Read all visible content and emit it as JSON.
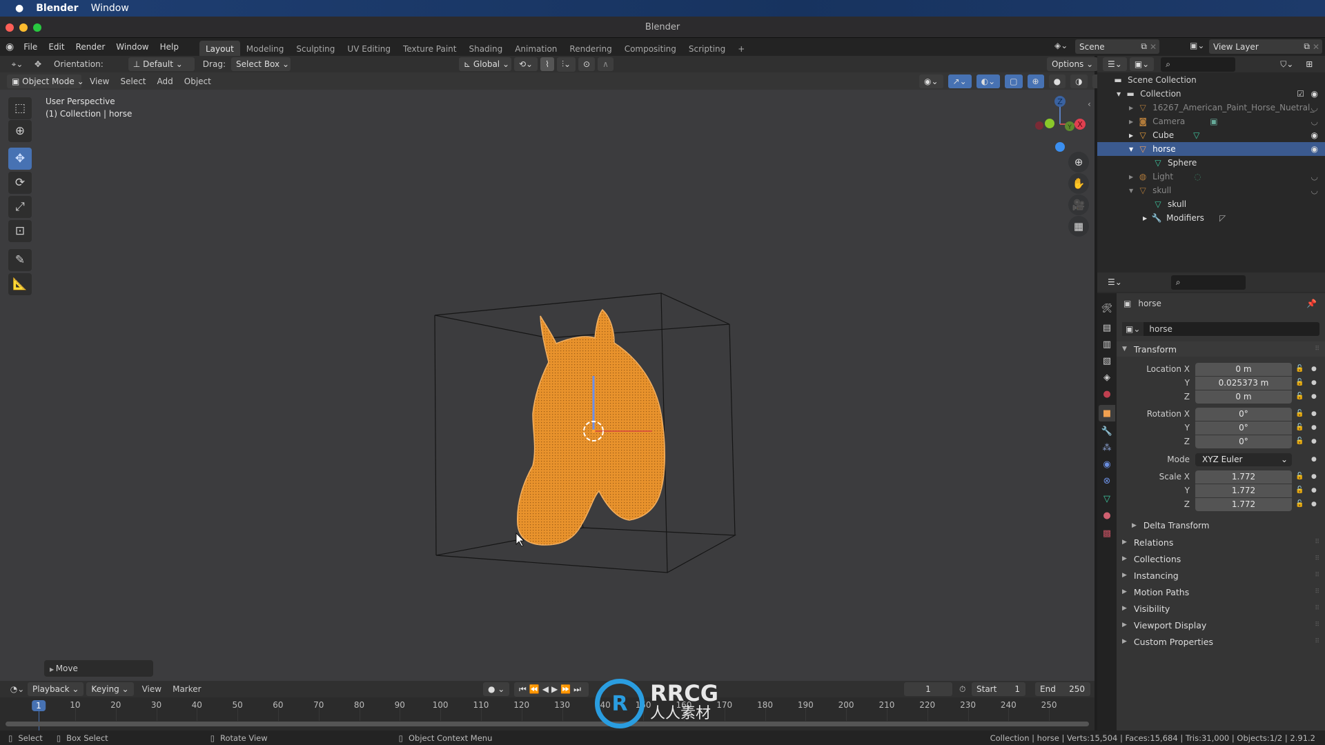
{
  "macos": {
    "app": "Blender",
    "menu": "Window"
  },
  "window": {
    "title": "Blender"
  },
  "topbar": {
    "menus": [
      "File",
      "Edit",
      "Render",
      "Window",
      "Help"
    ],
    "workspaces": [
      "Layout",
      "Modeling",
      "Sculpting",
      "UV Editing",
      "Texture Paint",
      "Shading",
      "Animation",
      "Rendering",
      "Compositing",
      "Scripting"
    ],
    "active_workspace": "Layout",
    "add_tab": "+",
    "scene": "Scene",
    "view_layer": "View Layer"
  },
  "toolheader": {
    "orientation_label": "Orientation:",
    "orientation_value": "Default",
    "drag_label": "Drag:",
    "drag_value": "Select Box",
    "transform_orientation": "Global",
    "options": "Options"
  },
  "viewheader": {
    "mode": "Object Mode",
    "menus": [
      "View",
      "Select",
      "Add",
      "Object"
    ]
  },
  "viewport": {
    "overlay_line1": "User Perspective",
    "overlay_line2": "(1) Collection | horse",
    "gizmo_axes": [
      "X",
      "Y",
      "Z"
    ],
    "last_operator": "Move",
    "tools": [
      "select-box",
      "cursor",
      "move",
      "rotate",
      "scale",
      "transform",
      "annotate",
      "measure"
    ],
    "active_tool": "move",
    "object_color": "#e8922c"
  },
  "outliner": {
    "root": "Scene Collection",
    "items": [
      {
        "label": "Collection",
        "icon": "collection"
      },
      {
        "label": "16267_American_Paint_Horse_Nuetral_",
        "icon": "mesh-object"
      },
      {
        "label": "Camera",
        "icon": "camera"
      },
      {
        "label": "Cube",
        "icon": "mesh-object"
      },
      {
        "label": "horse",
        "icon": "mesh-object",
        "selected": true
      },
      {
        "label": "Sphere",
        "icon": "mesh-data"
      },
      {
        "label": "Light",
        "icon": "light"
      },
      {
        "label": "skull",
        "icon": "mesh-object"
      },
      {
        "label": "skull",
        "icon": "mesh-data"
      },
      {
        "label": "Modifiers",
        "icon": "wrench"
      }
    ]
  },
  "properties": {
    "object_name": "horse",
    "name_field": "horse",
    "transform_title": "Transform",
    "location": {
      "label": "Location X",
      "x": "0 m",
      "y": "0.025373 m",
      "z": "0 m"
    },
    "rotation": {
      "label": "Rotation X",
      "x": "0°",
      "y": "0°",
      "z": "0°"
    },
    "mode": {
      "label": "Mode",
      "value": "XYZ Euler"
    },
    "scale": {
      "label": "Scale X",
      "x": "1.772",
      "y": "1.772",
      "z": "1.772"
    },
    "axis": {
      "y": "Y",
      "z": "Z"
    },
    "delta": "Delta Transform",
    "sections": [
      "Relations",
      "Collections",
      "Instancing",
      "Motion Paths",
      "Visibility",
      "Viewport Display",
      "Custom Properties"
    ]
  },
  "timeline": {
    "menus": [
      "Playback",
      "Keying",
      "View",
      "Marker"
    ],
    "current_frame": "1",
    "start_label": "Start",
    "start": "1",
    "end_label": "End",
    "end": "250",
    "ticks": [
      "1",
      "10",
      "20",
      "30",
      "40",
      "50",
      "60",
      "70",
      "80",
      "90",
      "100",
      "110",
      "120",
      "130",
      "140",
      "150",
      "160",
      "170",
      "180",
      "190",
      "200",
      "210",
      "220",
      "230",
      "240",
      "250"
    ]
  },
  "statusbar": {
    "select": "Select",
    "box_select": "Box Select",
    "rotate_view": "Rotate View",
    "context_menu": "Object Context Menu",
    "stats": "Collection | horse | Verts:15,504 | Faces:15,684 | Tris:31,000 | Objects:1/2 | 2.91.2"
  },
  "watermark": {
    "text": "RRCG",
    "sub": "人人素材"
  }
}
